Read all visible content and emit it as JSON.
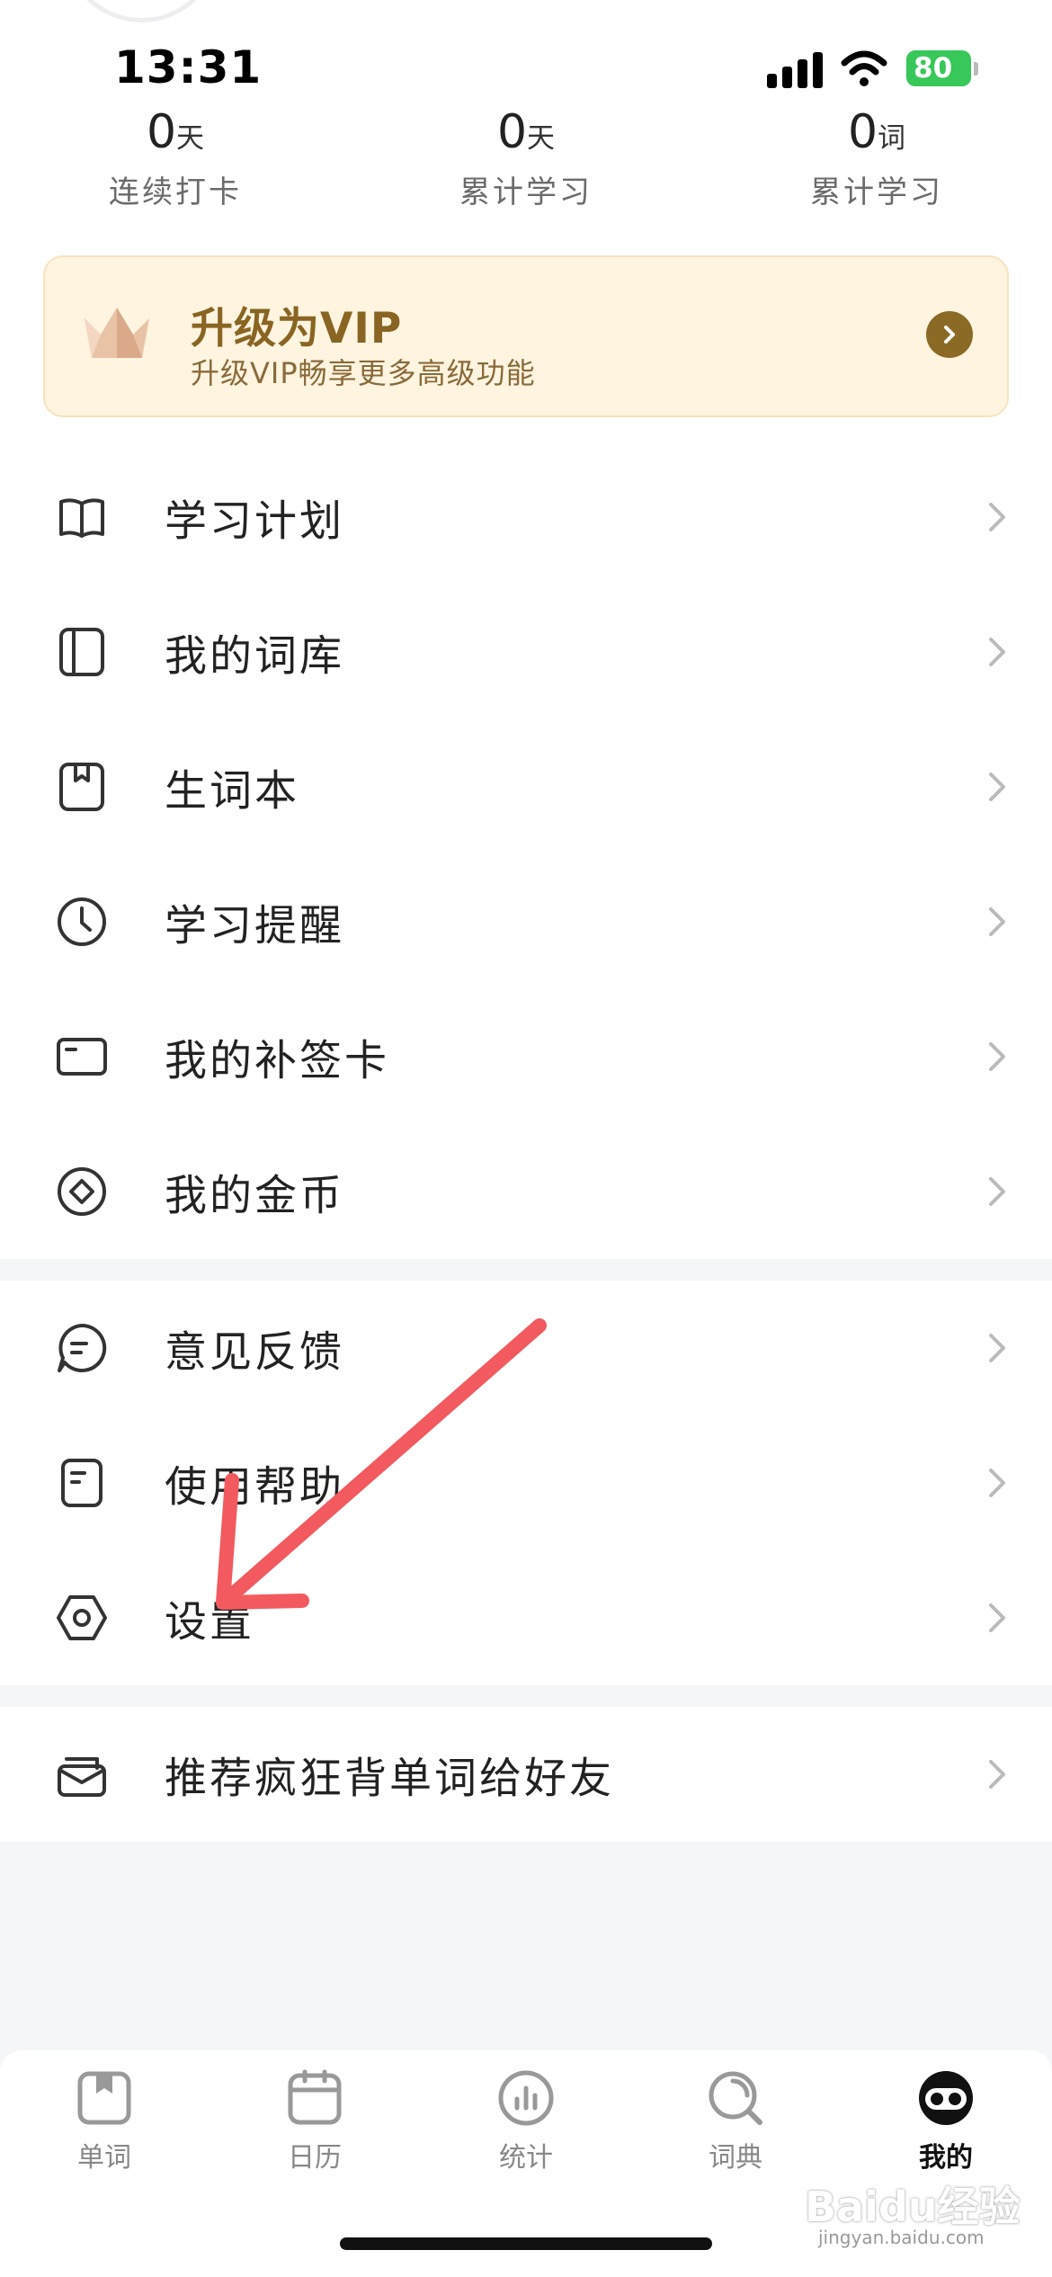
{
  "status": {
    "time": "13:31",
    "battery": "80"
  },
  "stats": [
    {
      "value": "0",
      "unit": "天",
      "label": "连续打卡"
    },
    {
      "value": "0",
      "unit": "天",
      "label": "累计学习"
    },
    {
      "value": "0",
      "unit": "词",
      "label": "累计学习"
    }
  ],
  "vip": {
    "title": "升级为VIP",
    "subtitle": "升级VIP畅享更多高级功能"
  },
  "menu1": [
    {
      "label": "学习计划",
      "icon": "book-open-icon"
    },
    {
      "label": "我的词库",
      "icon": "library-icon"
    },
    {
      "label": "生词本",
      "icon": "bookmark-book-icon"
    },
    {
      "label": "学习提醒",
      "icon": "clock-icon"
    },
    {
      "label": "我的补签卡",
      "icon": "card-icon"
    },
    {
      "label": "我的金币",
      "icon": "coin-icon"
    }
  ],
  "menu2": [
    {
      "label": "意见反馈",
      "icon": "feedback-icon"
    },
    {
      "label": "使用帮助",
      "icon": "help-doc-icon"
    },
    {
      "label": "设置",
      "icon": "settings-icon"
    }
  ],
  "menu3": [
    {
      "label": "推荐疯狂背单词给好友",
      "icon": "mail-icon"
    }
  ],
  "tabs": [
    {
      "label": "单词",
      "icon": "word-book-icon",
      "active": false
    },
    {
      "label": "日历",
      "icon": "calendar-icon",
      "active": false
    },
    {
      "label": "统计",
      "icon": "stats-icon",
      "active": false
    },
    {
      "label": "词典",
      "icon": "dictionary-icon",
      "active": false
    },
    {
      "label": "我的",
      "icon": "profile-face-icon",
      "active": true
    }
  ],
  "watermark": {
    "brand": "Baidu经验",
    "url": "jingyan.baidu.com"
  },
  "colors": {
    "accent_red": "#f25a5f",
    "vip_gold": "#8b6a26",
    "battery_green": "#38c759"
  }
}
